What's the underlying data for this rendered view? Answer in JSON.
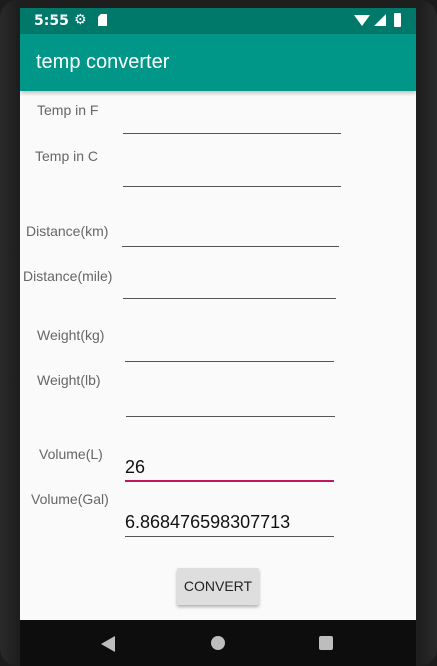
{
  "status_bar": {
    "time": "5:55",
    "icons": [
      "gear-icon",
      "sd-card-icon",
      "wifi-icon",
      "signal-icon",
      "battery-icon"
    ]
  },
  "app_bar": {
    "title": "temp converter",
    "color": "#009688"
  },
  "form": {
    "temp_f": {
      "label": "Temp in F",
      "value": ""
    },
    "temp_c": {
      "label": "Temp in C",
      "value": ""
    },
    "distance_km": {
      "label": "Distance(km)",
      "value": ""
    },
    "distance_mile": {
      "label": "Distance(mile)",
      "value": ""
    },
    "weight_kg": {
      "label": "Weight(kg)",
      "value": ""
    },
    "weight_lb": {
      "label": "Weight(lb)",
      "value": ""
    },
    "volume_l": {
      "label": "Volume(L)",
      "value": "26"
    },
    "volume_gal": {
      "label": "Volume(Gal)",
      "value": "6.868476598307713"
    }
  },
  "convert_button": {
    "label": "CONVERT"
  },
  "nav_bar": {
    "icons": [
      "back-icon",
      "home-icon",
      "recents-icon"
    ]
  }
}
